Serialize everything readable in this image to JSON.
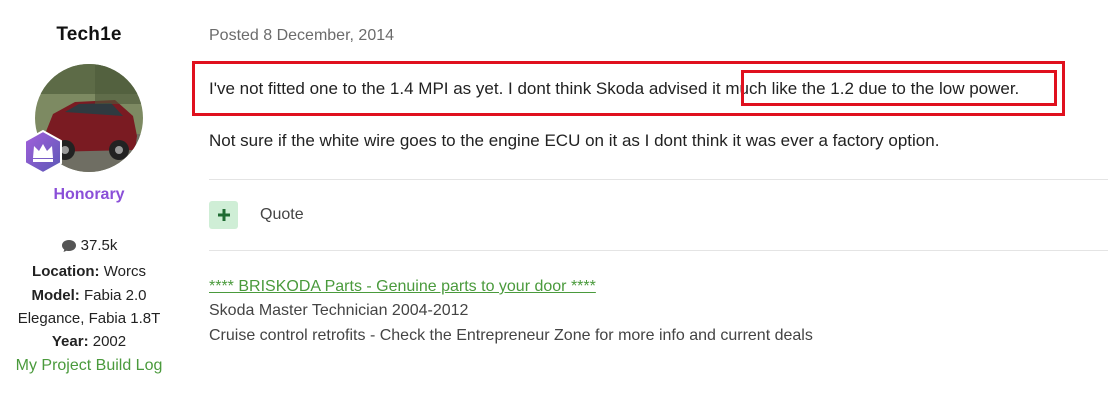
{
  "author": {
    "name": "Tech1e",
    "rank": "Honorary",
    "post_count": "37.5k",
    "location_label": "Location:",
    "location_value": "Worcs",
    "model_label": "Model:",
    "model_value_line1": "Fabia 2.0",
    "model_value_line2": "Elegance, Fabia 1.8T",
    "year_label": "Year:",
    "year_value": "2002",
    "build_log": "My Project Build Log"
  },
  "post": {
    "posted": "Posted 8 December, 2014",
    "paragraph1": "I've not fitted one to the 1.4 MPI as yet. I dont think Skoda advised it much like the 1.2 due to the low power.",
    "paragraph2": "Not sure if the white wire goes to the engine ECU on it as I dont think it was ever a factory option."
  },
  "actions": {
    "quote_label": "Quote"
  },
  "signature": {
    "link": "**** BRISKODA Parts - Genuine parts to your door ****",
    "line2": "Skoda Master Technician 2004-2012",
    "line3": "Cruise control retrofits - Check the Entrepreneur Zone for more info and current deals"
  },
  "icons": {
    "comment": "comment-icon",
    "crown": "crown-icon",
    "plus": "plus-icon"
  },
  "colors": {
    "rank": "#8a4fd8",
    "link_green": "#4a9a3c",
    "highlight_red": "#e0101e",
    "react_bg": "#cfeed6"
  }
}
